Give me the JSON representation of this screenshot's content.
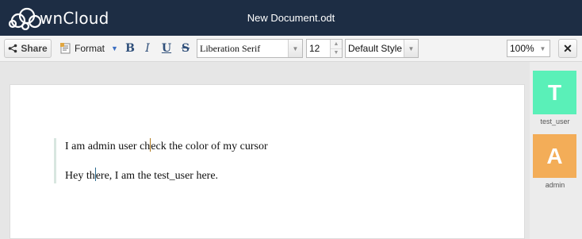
{
  "header": {
    "logo_text": "wnCloud",
    "document_title": "New Document.odt"
  },
  "toolbar": {
    "share_label": "Share",
    "share_icon": "share-icon",
    "format_label": "Format",
    "format_icon": "paragraph-format-icon",
    "bold_label": "B",
    "italic_label": "I",
    "underline_label": "U",
    "strike_label": "S",
    "font_family": "Liberation Serif",
    "font_size": "12",
    "paragraph_style": "Default Style",
    "zoom": "100%",
    "close_label": "✕"
  },
  "document": {
    "paragraphs": [
      {
        "before_cursor": "I am admin user ch",
        "after_cursor": "eck the color of my cursor",
        "cursor_user": "admin",
        "cursor_color": "#b07a1e"
      },
      {
        "before_cursor": "Hey th",
        "after_cursor": "ere, I am the test_user here.",
        "cursor_user": "test_user",
        "cursor_color": "#2a6a8e"
      }
    ]
  },
  "members": [
    {
      "initial": "T",
      "name": "test_user",
      "color": "#5af0b8"
    },
    {
      "initial": "A",
      "name": "admin",
      "color": "#f3ad58"
    }
  ],
  "colors": {
    "header_bg": "#1d2d44",
    "toolbar_bg": "#f3f3f3",
    "caret_blue": "#3b6ec2"
  }
}
